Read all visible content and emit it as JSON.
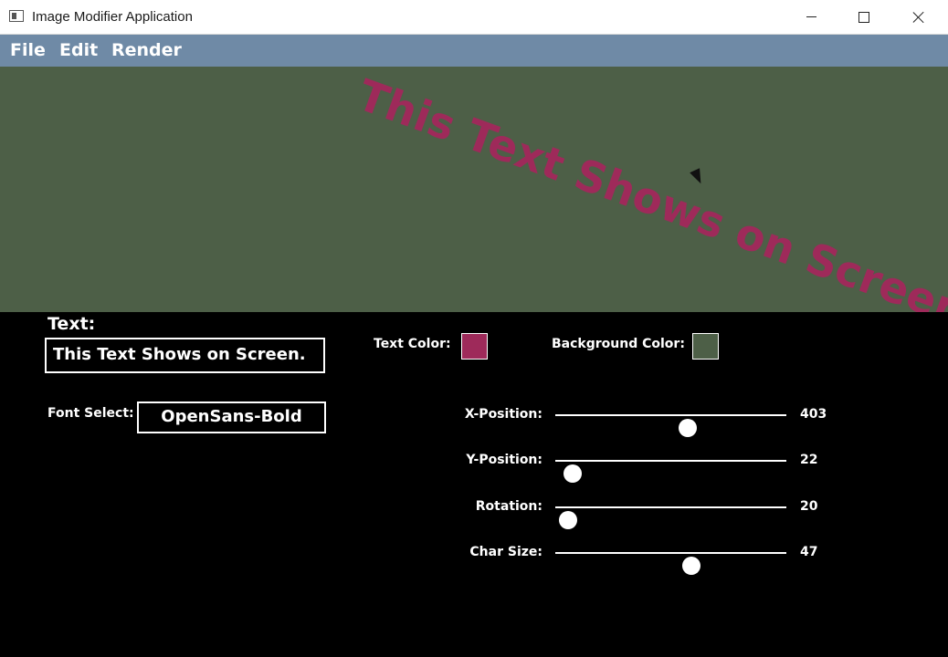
{
  "window": {
    "title": "Image Modifier Application"
  },
  "menu": {
    "items": [
      "File",
      "Edit",
      "Render"
    ]
  },
  "canvas": {
    "background_color": "#4d5f47",
    "text": "This Text Shows on Screen.",
    "text_color": "#9e2a5a"
  },
  "controls": {
    "text_label": "Text:",
    "text_value": "This Text Shows on Screen.",
    "font_label": "Font Select:",
    "font_value": "OpenSans-Bold",
    "text_color_label": "Text Color:",
    "text_color": "#9e2a5a",
    "background_color_label": "Background Color:",
    "background_color": "#4d5f47",
    "sliders": [
      {
        "label": "X-Position:",
        "value": "403",
        "fraction": 0.575
      },
      {
        "label": "Y-Position:",
        "value": "22",
        "fraction": 0.075
      },
      {
        "label": "Rotation:",
        "value": "20",
        "fraction": 0.055
      },
      {
        "label": "Char Size:",
        "value": "47",
        "fraction": 0.59
      }
    ]
  }
}
